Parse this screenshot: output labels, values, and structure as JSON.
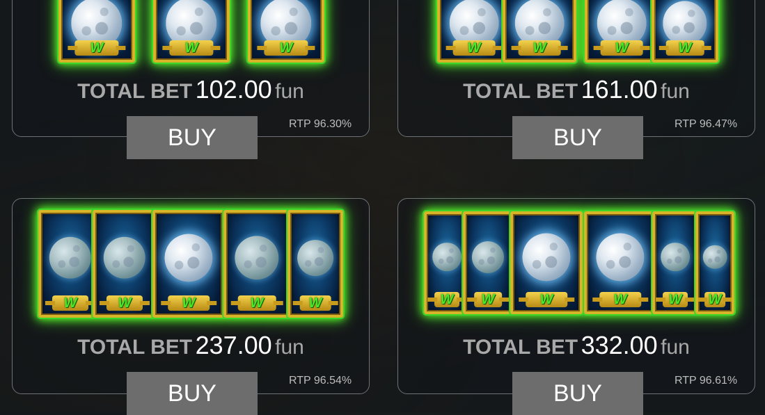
{
  "packages": [
    {
      "total_bet_label": "TOTAL BET",
      "amount": "102.00",
      "unit": "fun",
      "buy_label": "BUY",
      "rtp": "RTP 96.30%",
      "reel_count": 3
    },
    {
      "total_bet_label": "TOTAL BET",
      "amount": "161.00",
      "unit": "fun",
      "buy_label": "BUY",
      "rtp": "RTP 96.47%",
      "reel_count": 4
    },
    {
      "total_bet_label": "TOTAL BET",
      "amount": "237.00",
      "unit": "fun",
      "buy_label": "BUY",
      "rtp": "RTP 96.54%",
      "reel_count": 5
    },
    {
      "total_bet_label": "TOTAL BET",
      "amount": "332.00",
      "unit": "fun",
      "buy_label": "BUY",
      "rtp": "RTP 96.61%",
      "reel_count": 6
    }
  ],
  "symbol": {
    "badge_letter": "W",
    "icon": "moon-wild-icon"
  },
  "colors": {
    "accent_glow": "#5cff2a",
    "frame_gold": "#d7b428",
    "button": "#6d6d6d"
  }
}
